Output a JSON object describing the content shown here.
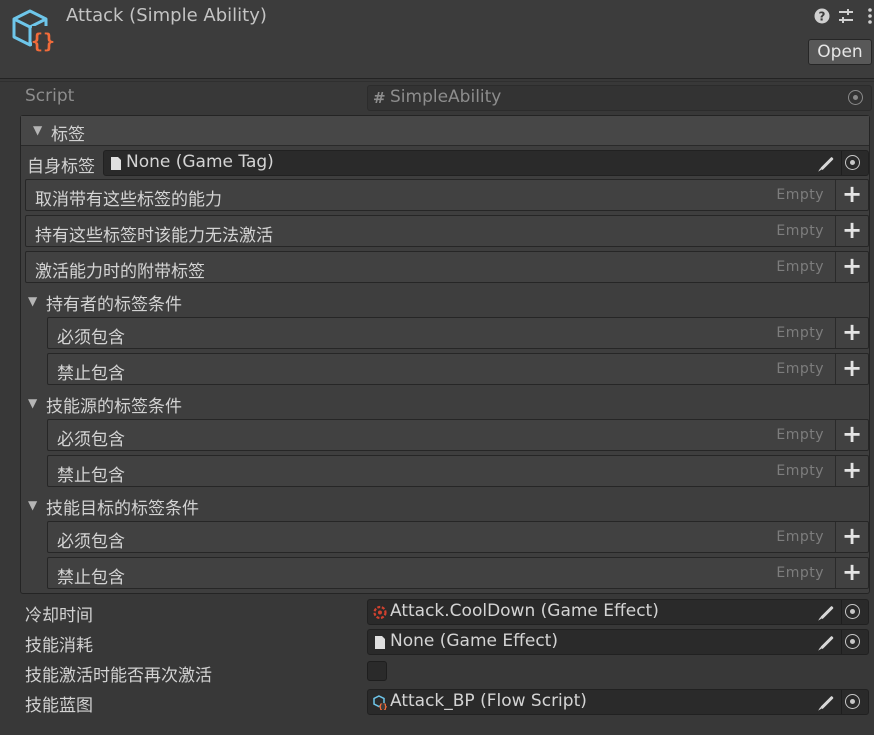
{
  "header": {
    "title": "Attack (Simple Ability)",
    "open_label": "Open",
    "icons": [
      "help-icon",
      "settings-sliders-icon",
      "more-vertical-icon"
    ]
  },
  "script_field": {
    "label": "Script",
    "value": "SimpleAbility"
  },
  "tags_section": {
    "title": "标签",
    "self_tag": {
      "label": "自身标签",
      "value": "None (Game Tag)"
    },
    "lists": [
      {
        "label": "取消带有这些标签的能力",
        "empty": "Empty"
      },
      {
        "label": "持有这些标签时该能力无法激活",
        "empty": "Empty"
      },
      {
        "label": "激活能力时的附带标签",
        "empty": "Empty"
      }
    ],
    "groups": [
      {
        "title": "持有者的标签条件",
        "items": [
          {
            "label": "必须包含",
            "empty": "Empty"
          },
          {
            "label": "禁止包含",
            "empty": "Empty"
          }
        ]
      },
      {
        "title": "技能源的标签条件",
        "items": [
          {
            "label": "必须包含",
            "empty": "Empty"
          },
          {
            "label": "禁止包含",
            "empty": "Empty"
          }
        ]
      },
      {
        "title": "技能目标的标签条件",
        "items": [
          {
            "label": "必须包含",
            "empty": "Empty"
          },
          {
            "label": "禁止包含",
            "empty": "Empty"
          }
        ]
      }
    ]
  },
  "fields": {
    "cooldown": {
      "label": "冷却时间",
      "value": "Attack.CoolDown (Game Effect)"
    },
    "cost": {
      "label": "技能消耗",
      "value": "None (Game Effect)"
    },
    "reactivate": {
      "label": "技能激活时能否再次激活",
      "checked": false
    },
    "blueprint": {
      "label": "技能蓝图",
      "value": "Attack_BP (Flow Script)"
    }
  },
  "colors": {
    "background": "#383838",
    "field_bg": "#2a2a2a",
    "effect_icon": "#d0412f",
    "script_icon_blue": "#6ec6ea",
    "script_icon_orange": "#f26b3a"
  }
}
